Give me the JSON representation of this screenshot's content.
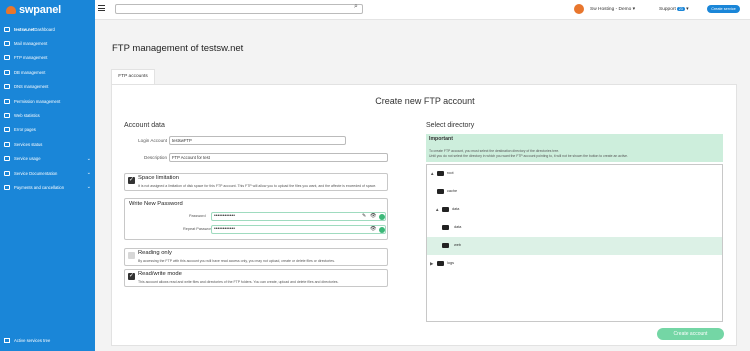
{
  "brand": "swpanel",
  "sidebar": {
    "items": [
      {
        "label": "testsw.net",
        "suffix": " Dashboard"
      },
      {
        "label": "Mail management"
      },
      {
        "label": "FTP management"
      },
      {
        "label": "DB management"
      },
      {
        "label": "DNS management"
      },
      {
        "label": "Permission management"
      },
      {
        "label": "Web statistics"
      },
      {
        "label": "Error pages"
      },
      {
        "label": "Services status"
      },
      {
        "label": "Service usage"
      },
      {
        "label": "Service Documentation"
      },
      {
        "label": "Payments and cancellation"
      }
    ],
    "footer": "Active services tree"
  },
  "topbar": {
    "search_placeholder": "",
    "user": "Sw Hosting - Demo",
    "support": "Support",
    "support_badge": "23",
    "create_service": "Create service"
  },
  "page_title": "FTP management of testsw.net",
  "tab": "FTP accounts",
  "card_title": "Create new FTP account",
  "account": {
    "section": "Account data",
    "login_label": "Login Account",
    "login_value": "testswFTP",
    "desc_label": "Description",
    "desc_value": "FTP Account for test"
  },
  "space": {
    "title": "Space limitation",
    "desc": "It is not assigned a limitation of disk space for this FTP account. This FTP will allow you to upload the files you want, and the affecte is exceeded of space."
  },
  "password": {
    "section": "Write New Password",
    "pw_label": "Password",
    "pw_value": "••••••••••••",
    "repeat_label": "Repeat Password",
    "repeat_value": "••••••••••••"
  },
  "reading": {
    "title": "Reading only",
    "desc": "By accessing the FTP with this account you will have read access only, you may not upload, create or delete files or directories."
  },
  "readwrite": {
    "title": "Read/write mode",
    "desc": "This account allows read and write files and directories of the FTP folders. You can create, upload and delete files and directories."
  },
  "directory": {
    "section": "Select directory",
    "important_title": "Important",
    "important_text_1": "To create FTP account, you must select the destination directory of the directories tree.",
    "important_text_2": "Until you do not select the directory in which you want the FTP account pointing to, it will not be shown the button to create an active.",
    "tree": [
      {
        "name": "root",
        "toggle": "▲"
      },
      {
        "name": "cache",
        "toggle": ""
      },
      {
        "name": "data",
        "toggle": "▲"
      },
      {
        "name": "data",
        "toggle": ""
      },
      {
        "name": "web",
        "toggle": ""
      },
      {
        "name": "logs",
        "toggle": "▶"
      }
    ]
  },
  "create_button": "Create account"
}
